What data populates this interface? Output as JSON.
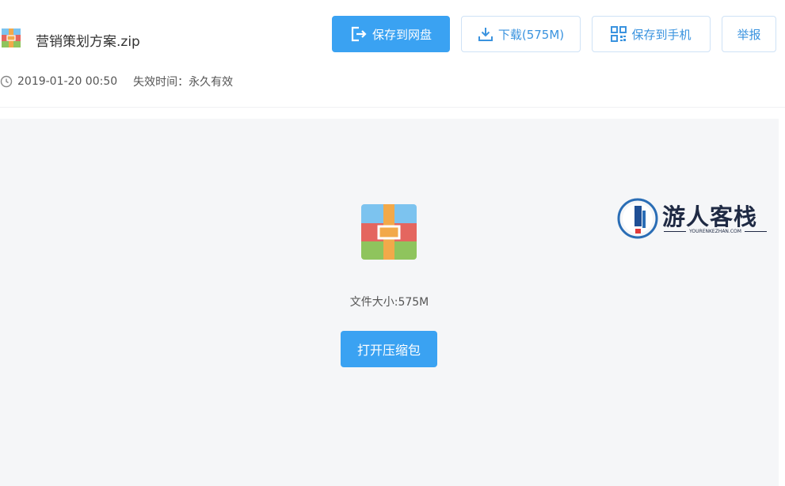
{
  "file": {
    "name": "营销策划方案.zip",
    "date": "2019-01-20 00:50",
    "expire": "失效时间：永久有效"
  },
  "actions": {
    "save_to_cloud": "保存到网盘",
    "download": "下载(575M)",
    "save_to_phone": "保存到手机",
    "report": "举报"
  },
  "preview": {
    "size_text": "文件大小:575M",
    "open_button": "打开压缩包"
  },
  "watermark": {
    "title": "游人客栈",
    "subtitle": "YOURENKEZHAN.COM"
  },
  "colors": {
    "primary": "#3aa2f2",
    "outline_text": "#3a93df",
    "preview_bg": "#f5f6f8"
  },
  "icons": [
    "zip-file-icon",
    "clock-icon",
    "save-cloud-icon",
    "download-icon",
    "qr-code-icon"
  ]
}
